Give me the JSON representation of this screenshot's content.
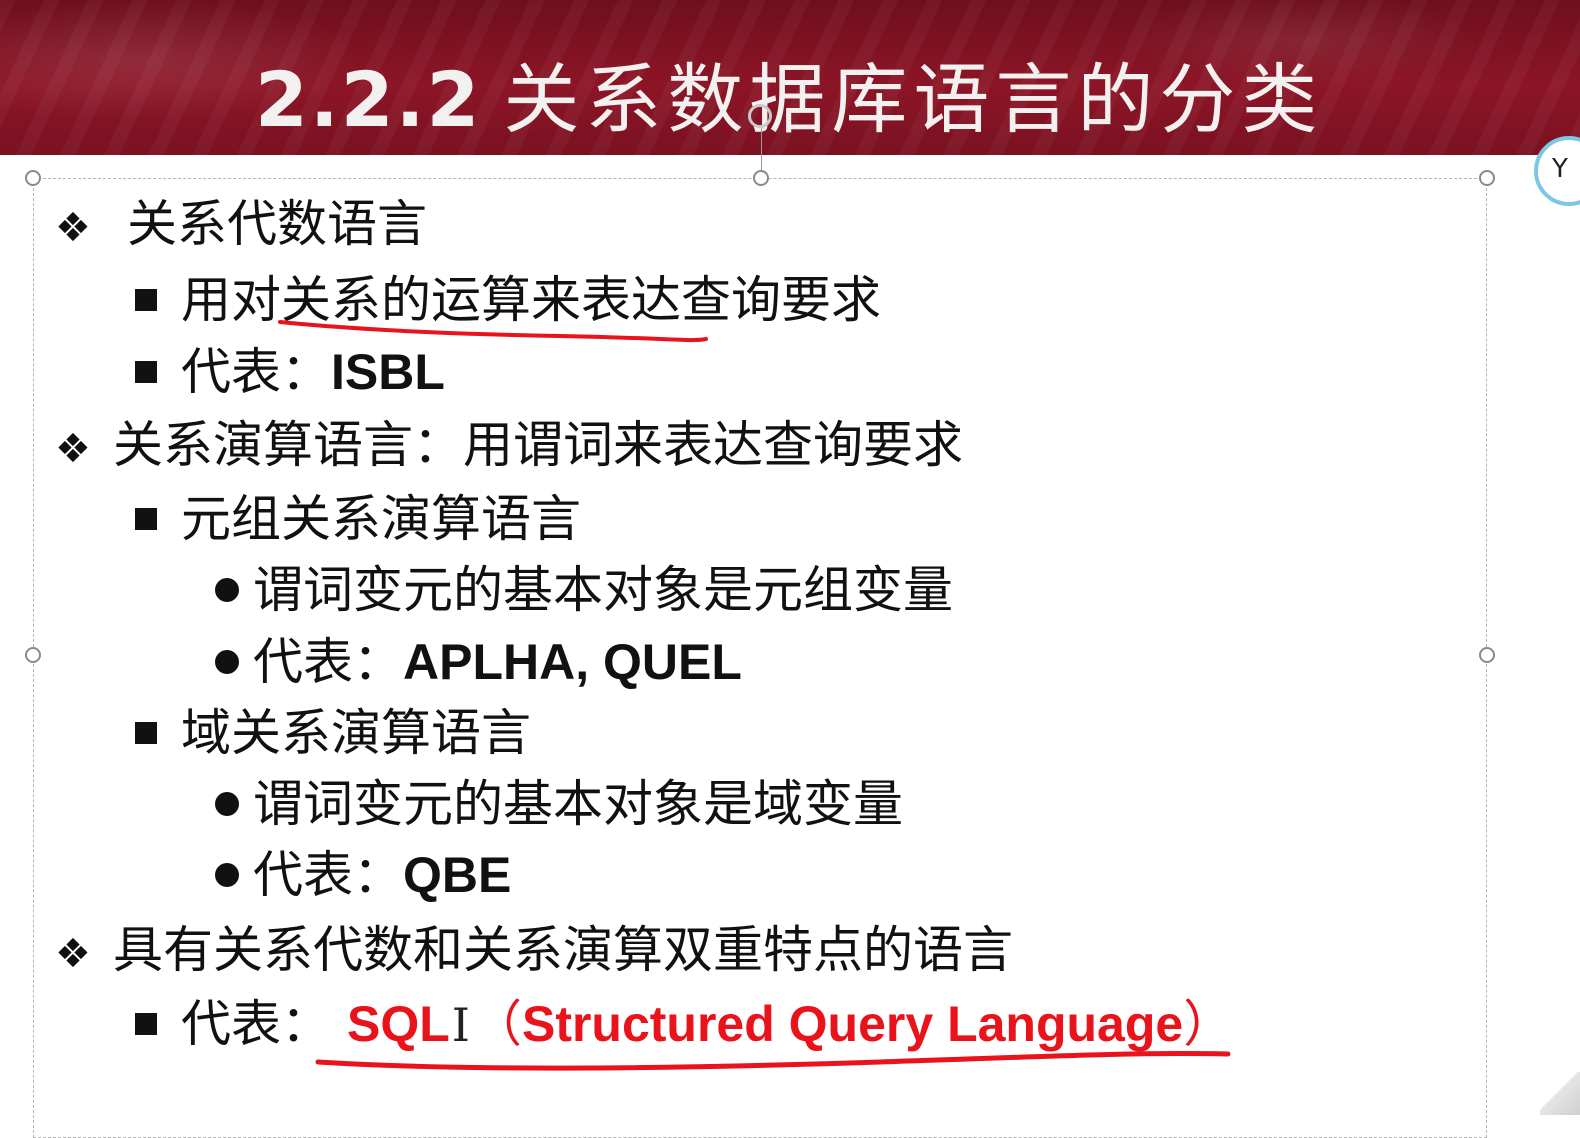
{
  "slide": {
    "title_number": "2.2.2",
    "title_text": "关系数据库语言的分类"
  },
  "lines": [
    {
      "level": 1,
      "text": "关系代数语言"
    },
    {
      "level": 2,
      "text": "用对关系的运算来表达查询要求"
    },
    {
      "level": 2,
      "prefix": "代表：",
      "code": "ISBL"
    },
    {
      "level": 1,
      "text": "关系演算语言：用谓词来表达查询要求"
    },
    {
      "level": 2,
      "text": "元组关系演算语言"
    },
    {
      "level": 3,
      "text": "谓词变元的基本对象是元组变量"
    },
    {
      "level": 3,
      "prefix": "代表：",
      "code": "APLHA, QUEL"
    },
    {
      "level": 2,
      "text": "域关系演算语言"
    },
    {
      "level": 3,
      "text": "谓词变元的基本对象是域变量"
    },
    {
      "level": 3,
      "prefix": "代表：",
      "code": "QBE"
    },
    {
      "level": 1,
      "text": "具有关系代数和关系演算双重特点的语言"
    },
    {
      "level": 2,
      "prefix": "代表：",
      "code": "SQL",
      "paren_open": "（",
      "code_full": "Structured Query Language",
      "paren_close": "）"
    }
  ],
  "colors": {
    "title_bar": "#7a1121",
    "title_text": "#f3f0f0",
    "body_text": "#111111",
    "highlight_red": "#e8131b",
    "selection_border": "#b4b4b4"
  },
  "icons": {
    "level1_bullet": "diamond-bullet-icon",
    "level2_bullet": "square-bullet-icon",
    "level3_bullet": "dot-bullet-icon",
    "cursor": "text-cursor-icon",
    "rotate": "rotate-handle-icon"
  }
}
